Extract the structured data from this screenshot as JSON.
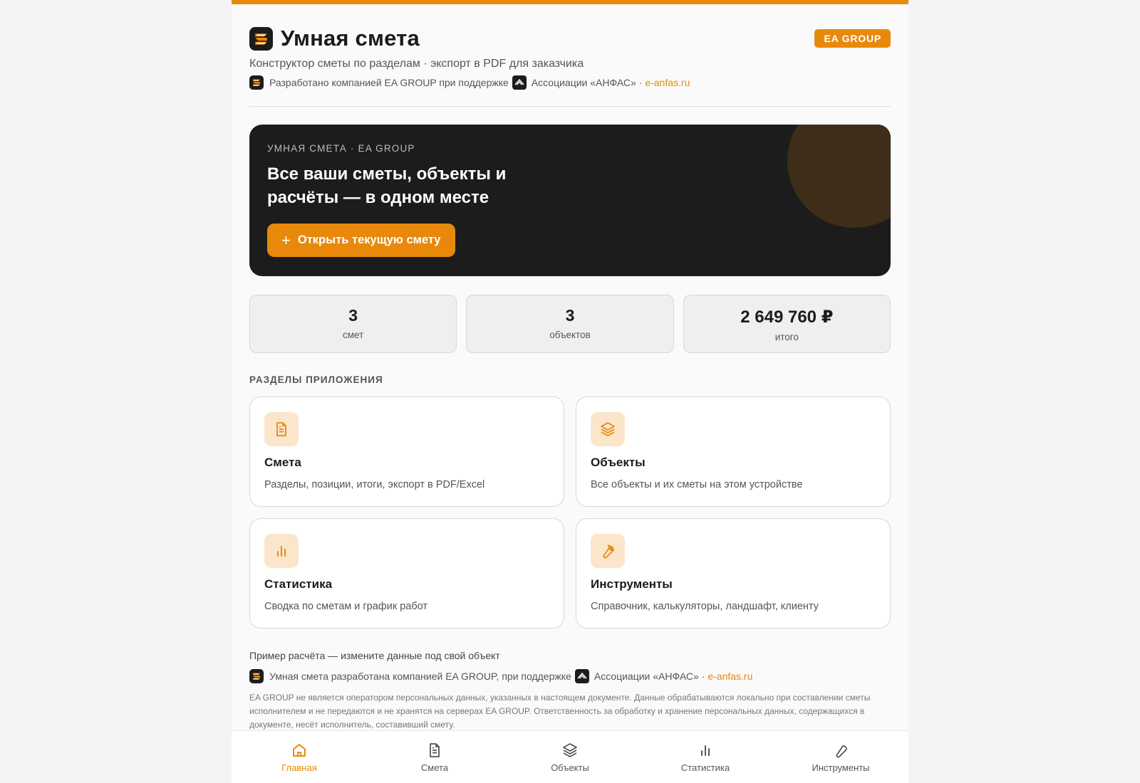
{
  "colors": {
    "accent": "#e8890c",
    "dark": "#1c1c1c"
  },
  "header": {
    "title": "Умная смета",
    "badge": "EA GROUP",
    "subtitle": "Конструктор сметы по разделам · экспорт в PDF для заказчика",
    "credit_prefix": "Разработано компанией EA GROUP при поддержке",
    "credit_assoc": "Ассоциации «АНФАС» ·",
    "credit_link": "e-anfas.ru"
  },
  "hero": {
    "eyebrow": "УМНАЯ СМЕТА · EA GROUP",
    "title": "Все ваши сметы, объекты и расчёты — в одном месте",
    "button_label": "Открыть текущую смету"
  },
  "stats": [
    {
      "value": "3",
      "label": "смет"
    },
    {
      "value": "3",
      "label": "объектов"
    },
    {
      "value": "2 649 760 ₽",
      "label": "итого"
    }
  ],
  "sections": {
    "title": "РАЗДЕЛЫ ПРИЛОЖЕНИЯ",
    "cards": [
      {
        "icon": "document-icon",
        "title": "Смета",
        "desc": "Разделы, позиции, итоги, экспорт в PDF/Excel"
      },
      {
        "icon": "layers-icon",
        "title": "Объекты",
        "desc": "Все объекты и их сметы на этом устройстве"
      },
      {
        "icon": "bar-chart-icon",
        "title": "Статистика",
        "desc": "Сводка по сметам и график работ"
      },
      {
        "icon": "wrench-icon",
        "title": "Инструменты",
        "desc": "Справочник, калькуляторы, ландшафт, клиенту"
      }
    ]
  },
  "footer": {
    "example": "Пример расчёта — измените данные под свой объект",
    "credit_prefix": "Умная смета разработана компанией EA GROUP, при поддержке",
    "credit_assoc": "Ассоциации «АНФАС» ·",
    "credit_link": "e-anfas.ru",
    "disclaimer": "EA GROUP не является оператором персональных данных, указанных в настоящем документе. Данные обрабатываются локально при составлении сметы исполнителем и не передаются и не хранятся на серверах EA GROUP. Ответственность за обработку и хранение персональных данных, содержащихся в документе, несёт исполнитель, составивший смету."
  },
  "tabbar": [
    {
      "icon": "home-icon",
      "label": "Главная",
      "active": true
    },
    {
      "icon": "document-icon",
      "label": "Смета"
    },
    {
      "icon": "layers-icon",
      "label": "Объекты"
    },
    {
      "icon": "bar-chart-icon",
      "label": "Статистика"
    },
    {
      "icon": "wrench-icon",
      "label": "Инструменты"
    }
  ]
}
